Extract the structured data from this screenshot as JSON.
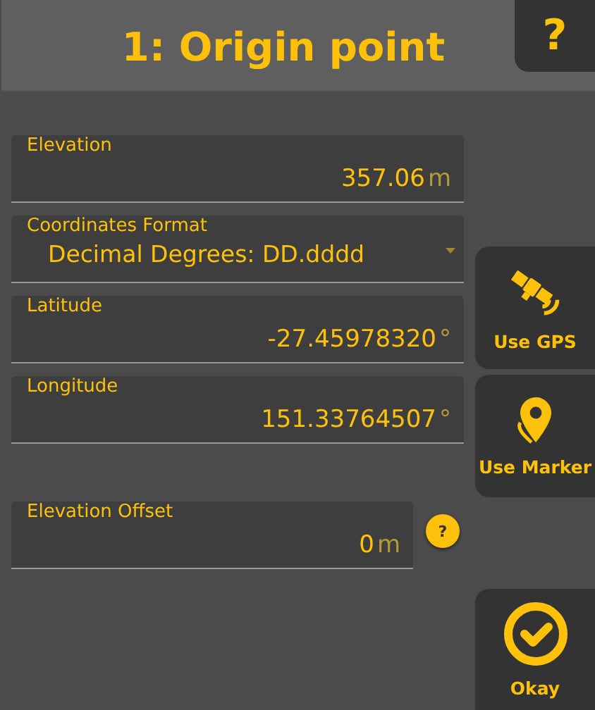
{
  "header": {
    "title": "1: Origin point",
    "help": "?"
  },
  "fields": [
    {
      "kind": "number",
      "label": "Elevation",
      "value": "357.06",
      "unit": "m"
    },
    {
      "kind": "dropdown",
      "label": "Coordinates Format",
      "value": "Decimal Degrees: DD.dddd"
    },
    {
      "kind": "number",
      "label": "Latitude",
      "value": "-27.45978320",
      "unit": "°"
    },
    {
      "kind": "number",
      "label": "Longitude",
      "value": "151.33764507",
      "unit": "°"
    }
  ],
  "offset": {
    "label": "Elevation Offset",
    "value": "0",
    "unit": "m",
    "help": "?"
  },
  "buttons": [
    {
      "kind": "gps",
      "label": "Use GPS"
    },
    {
      "kind": "marker",
      "label": "Use Marker"
    },
    {
      "kind": "okay",
      "label": "Okay"
    }
  ]
}
